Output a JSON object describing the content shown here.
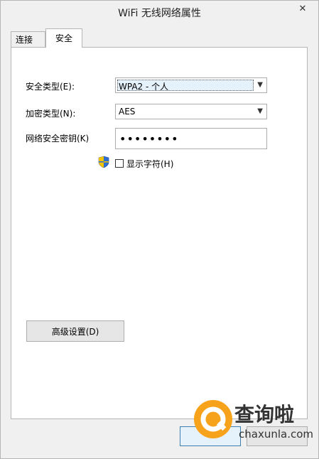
{
  "window": {
    "title": "WiFi 无线网络属性",
    "close_glyph": "✕"
  },
  "tabs": [
    {
      "label": "连接"
    },
    {
      "label": "安全"
    }
  ],
  "security": {
    "security_type_label": "安全类型(E):",
    "security_type_value": "WPA2 - 个人",
    "encryption_type_label": "加密类型(N):",
    "encryption_type_value": "AES",
    "network_key_label": "网络安全密钥(K)",
    "network_key_value": "••••••••",
    "show_chars_label": "显示字符(H)",
    "show_chars_checked": false
  },
  "advanced_button_label": "高级设置(D)",
  "watermark": {
    "brand": "查询啦",
    "domain": "chaxunla.com"
  },
  "colors": {
    "accent": "#3c7fb1",
    "watermark_icon": "#f7a21b"
  }
}
